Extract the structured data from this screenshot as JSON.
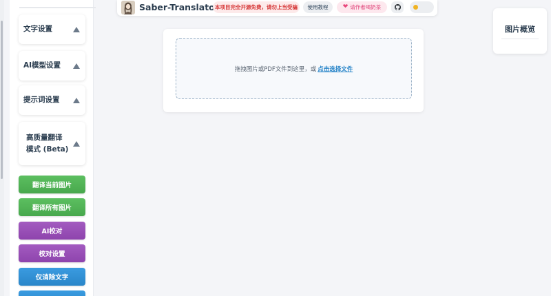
{
  "header": {
    "app_title": "Saber-Translator",
    "notice": "本项目完全开源免费，请勿上当受骗",
    "tutorial_label": "使用教程",
    "support_label": "请作者喝奶茶",
    "icons": {
      "logo": "avatar-logo",
      "support": "heart-icon",
      "github": "github-icon",
      "theme": "theme-toggle-icon"
    },
    "colors": {
      "notice_text": "#d63a3a",
      "support_text": "#e0457b"
    }
  },
  "sidebar": {
    "panels": [
      {
        "label": "文字设置"
      },
      {
        "label": "AI模型设置"
      },
      {
        "label": "提示词设置"
      },
      {
        "label": "高质量翻译模式 (Beta)"
      }
    ],
    "buttons": [
      {
        "label": "翻译当前图片",
        "color": "#4caf50"
      },
      {
        "label": "翻译所有图片",
        "color": "#4caf50"
      },
      {
        "label": "AI校对",
        "color": "#9b59b6"
      },
      {
        "label": "校对设置",
        "color": "#9b59b6"
      },
      {
        "label": "仅消除文字",
        "color": "#3498db"
      },
      {
        "label": "",
        "color": "#3498db"
      }
    ]
  },
  "upload": {
    "prompt_text": "拖拽图片或PDF文件到这里，或",
    "link_text": "点击选择文件"
  },
  "overview": {
    "title": "图片概览"
  }
}
